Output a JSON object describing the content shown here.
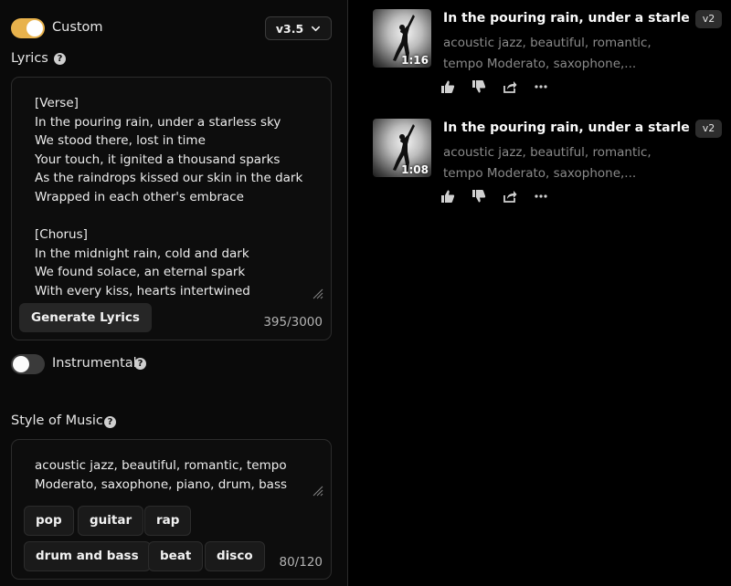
{
  "left": {
    "custom_toggle": {
      "label": "Custom",
      "on": true
    },
    "version": {
      "label": "v3.5"
    },
    "lyrics": {
      "label": "Lyrics",
      "text": "[Verse]\nIn the pouring rain, under a starless sky\nWe stood there, lost in time\nYour touch, it ignited a thousand sparks\nAs the raindrops kissed our skin in the dark\nWrapped in each other's embrace\n\n[Chorus]\nIn the midnight rain, cold and dark\nWe found solace, an eternal spark\nWith every kiss, hearts intertwined",
      "generate_label": "Generate Lyrics",
      "counter": "395/3000"
    },
    "instrumental_toggle": {
      "label": "Instrumental",
      "on": false
    },
    "style": {
      "label": "Style of Music",
      "text": "acoustic jazz, beautiful, romantic, tempo Moderato, saxophone, piano, drum, bass",
      "tags": [
        "pop",
        "guitar",
        "rap",
        "drum and bass",
        "beat",
        "disco"
      ],
      "counter": "80/120"
    }
  },
  "songs": [
    {
      "title": "In the pouring rain, under a starless sky",
      "version": "v2",
      "tags": "acoustic jazz, beautiful, romantic, tempo Moderato, saxophone,...",
      "duration": "1:16"
    },
    {
      "title": "In the pouring rain, under a starless sky",
      "version": "v2",
      "tags": "acoustic jazz, beautiful, romantic, tempo Moderato, saxophone,...",
      "duration": "1:08"
    }
  ],
  "icons": {
    "help": "question-circle-icon",
    "chevron": "chevron-down-icon",
    "like": "thumbs-up-icon",
    "dislike": "thumbs-down-icon",
    "share": "share-icon",
    "more": "more-horizontal-icon"
  },
  "colors": {
    "accent": "#e8b24c",
    "background": "#000000",
    "panel": "#0a0a0a"
  }
}
